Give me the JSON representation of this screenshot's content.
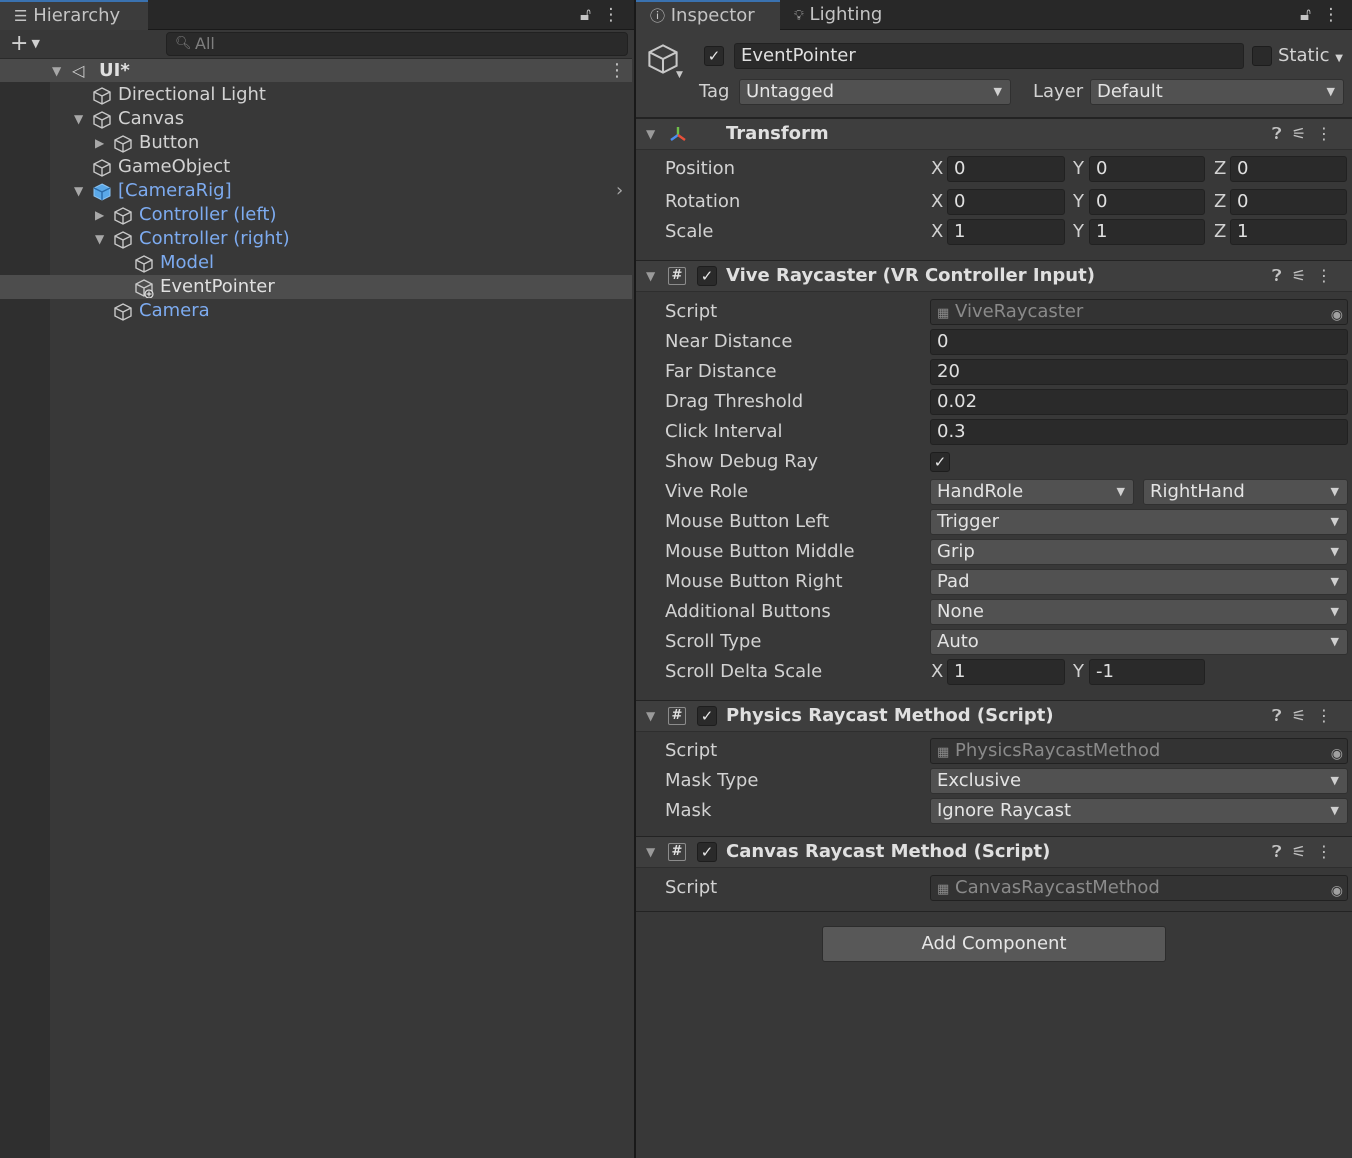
{
  "hierarchy": {
    "tab_label": "Hierarchy",
    "search_placeholder": "All",
    "scene_name": "UI*",
    "items": [
      {
        "label": "Directional Light"
      },
      {
        "label": "Canvas"
      },
      {
        "label": "Button"
      },
      {
        "label": "GameObject"
      },
      {
        "label": "[CameraRig]"
      },
      {
        "label": "Controller (left)"
      },
      {
        "label": "Controller (right)"
      },
      {
        "label": "Model"
      },
      {
        "label": "EventPointer"
      },
      {
        "label": "Camera"
      }
    ]
  },
  "inspector": {
    "tabs": [
      {
        "label": "Inspector"
      },
      {
        "label": "Lighting"
      }
    ],
    "object": {
      "name": "EventPointer",
      "static_label": "Static",
      "tag_label": "Tag",
      "tag_value": "Untagged",
      "layer_label": "Layer",
      "layer_value": "Default"
    },
    "transform": {
      "title": "Transform",
      "rows": [
        {
          "label": "Position",
          "x": "0",
          "y": "0",
          "z": "0"
        },
        {
          "label": "Rotation",
          "x": "0",
          "y": "0",
          "z": "0"
        },
        {
          "label": "Scale",
          "x": "1",
          "y": "1",
          "z": "1"
        }
      ]
    },
    "vive_raycaster": {
      "title": "Vive Raycaster (VR Controller Input)",
      "script_label": "Script",
      "script_value": "ViveRaycaster",
      "near_distance_label": "Near Distance",
      "near_distance": "0",
      "far_distance_label": "Far Distance",
      "far_distance": "20",
      "drag_threshold_label": "Drag Threshold",
      "drag_threshold": "0.02",
      "click_interval_label": "Click Interval",
      "click_interval": "0.3",
      "show_debug_ray_label": "Show Debug Ray",
      "vive_role_label": "Vive Role",
      "vive_role_type": "HandRole",
      "vive_role_value": "RightHand",
      "mouse_left_label": "Mouse Button Left",
      "mouse_left": "Trigger",
      "mouse_middle_label": "Mouse Button Middle",
      "mouse_middle": "Grip",
      "mouse_right_label": "Mouse Button Right",
      "mouse_right": "Pad",
      "additional_label": "Additional Buttons",
      "additional": "None",
      "scroll_type_label": "Scroll Type",
      "scroll_type": "Auto",
      "scroll_delta_label": "Scroll Delta Scale",
      "scroll_delta_x": "1",
      "scroll_delta_y": "-1"
    },
    "physics_raycast": {
      "title": "Physics Raycast Method (Script)",
      "script_label": "Script",
      "script_value": "PhysicsRaycastMethod",
      "mask_type_label": "Mask Type",
      "mask_type": "Exclusive",
      "mask_label": "Mask",
      "mask": "Ignore Raycast"
    },
    "canvas_raycast": {
      "title": "Canvas Raycast Method (Script)",
      "script_label": "Script",
      "script_value": "CanvasRaycastMethod"
    },
    "axis": {
      "x": "X",
      "y": "Y",
      "z": "Z"
    },
    "add_component_label": "Add Component"
  }
}
